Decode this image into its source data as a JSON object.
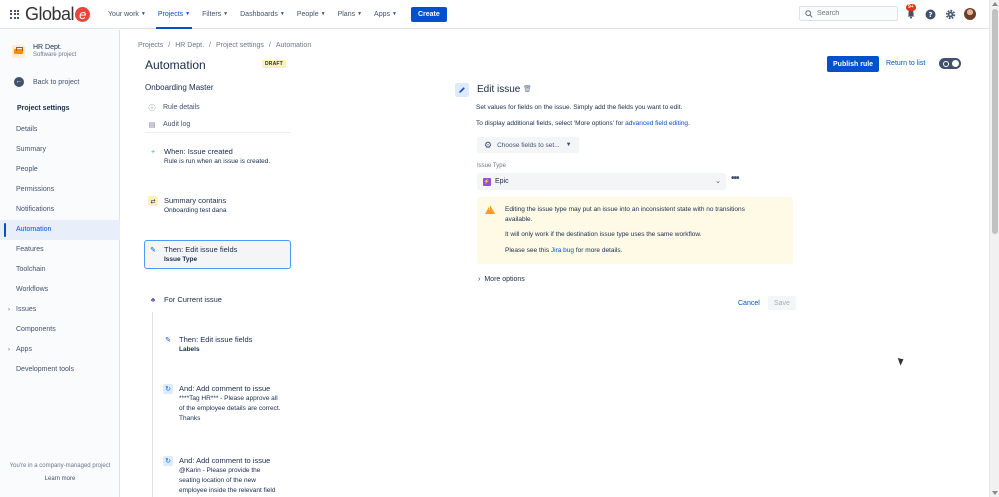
{
  "topnav": {
    "logo_text": "Global",
    "logo_e": "e",
    "items": [
      {
        "label": "Your work",
        "active": false
      },
      {
        "label": "Projects",
        "active": true
      },
      {
        "label": "Filters",
        "active": false
      },
      {
        "label": "Dashboards",
        "active": false
      },
      {
        "label": "People",
        "active": false
      },
      {
        "label": "Plans",
        "active": false
      },
      {
        "label": "Apps",
        "active": false
      }
    ],
    "create_label": "Create",
    "search_placeholder": "Search",
    "notification_badge": "9+",
    "icons": [
      "grid-icon",
      "search-icon",
      "bell-icon",
      "help-icon",
      "gear-icon",
      "avatar"
    ]
  },
  "sidebar": {
    "project_name": "HR Dept.",
    "project_type": "Software project",
    "back_label": "Back to project",
    "section_title": "Project settings",
    "items": [
      {
        "label": "Details",
        "active": false,
        "expandable": false
      },
      {
        "label": "Summary",
        "active": false,
        "expandable": false
      },
      {
        "label": "People",
        "active": false,
        "expandable": false
      },
      {
        "label": "Permissions",
        "active": false,
        "expandable": false
      },
      {
        "label": "Notifications",
        "active": false,
        "expandable": false
      },
      {
        "label": "Automation",
        "active": true,
        "expandable": false
      },
      {
        "label": "Features",
        "active": false,
        "expandable": false
      },
      {
        "label": "Toolchain",
        "active": false,
        "expandable": false
      },
      {
        "label": "Workflows",
        "active": false,
        "expandable": false
      },
      {
        "label": "Issues",
        "active": false,
        "expandable": true
      },
      {
        "label": "Components",
        "active": false,
        "expandable": false
      },
      {
        "label": "Apps",
        "active": false,
        "expandable": true
      },
      {
        "label": "Development tools",
        "active": false,
        "expandable": false
      }
    ],
    "footer_text": "You're in a company-managed project",
    "footer_link": "Learn more"
  },
  "header": {
    "breadcrumb": [
      "Projects",
      "HR Dept.",
      "Project settings",
      "Automation"
    ],
    "title": "Automation",
    "status_lozenge": "DRAFT",
    "publish_label": "Publish rule",
    "return_label": "Return to list"
  },
  "rule": {
    "name": "Onboarding Master",
    "links": [
      {
        "label": "Rule details",
        "icon": "info-icon"
      },
      {
        "label": "Audit log",
        "icon": "document-icon"
      }
    ],
    "steps": [
      {
        "title": "When: Issue created",
        "sub": "Rule is run when an issue is created.",
        "icon": "trigger-plus-icon",
        "selected": false
      },
      {
        "title": "Summary contains",
        "sub": "Onboarding test dana",
        "icon": "condition-shuffle-icon",
        "selected": false
      },
      {
        "title": "Then: Edit issue fields",
        "sub": "Issue Type",
        "icon": "pencil-icon",
        "selected": true
      },
      {
        "title": "For Current issue",
        "sub": "",
        "icon": "branch-icon",
        "selected": false
      },
      {
        "title": "Then: Edit issue fields",
        "sub": "Labels",
        "icon": "pencil-icon",
        "selected": false
      },
      {
        "title": "And: Add comment to issue",
        "sub_lines": [
          "****Tag HR*** - Please approve all",
          "of the employee details are correct.",
          "Thanks"
        ],
        "icon": "refresh-icon",
        "selected": false
      },
      {
        "title": "And: Add comment to issue",
        "sub_lines": [
          "@Karin - Please provide the",
          "seating location of the new",
          "employee inside the relevant field"
        ],
        "icon": "refresh-icon",
        "selected": false
      }
    ]
  },
  "edit_panel": {
    "title": "Edit issue",
    "desc1": "Set values for fields on the issue. Simply add the fields you want to edit.",
    "desc2_pre": "To display additional fields, select 'More options' for ",
    "desc2_link": "advanced field editing",
    "desc2_post": ".",
    "choose_label": "Choose fields to set...",
    "field_label": "Issue Type",
    "field_value": "Epic",
    "warning": {
      "line1": "Editing the issue type may put an issue into an inconsistent state with no transitions",
      "line2": "available.",
      "line3": "It will only work if the destination issue type uses the same workflow.",
      "line4_pre": "Please see this ",
      "line4_link": "Jira bug",
      "line4_post": " for more details."
    },
    "more_options": "More options",
    "cancel_label": "Cancel",
    "save_label": "Save"
  },
  "colors": {
    "brand": "#0052cc",
    "logo_accent": "#e8453c",
    "warning_bg": "#fffae6",
    "warning_icon": "#ff991f",
    "epic": "#904ee2"
  }
}
